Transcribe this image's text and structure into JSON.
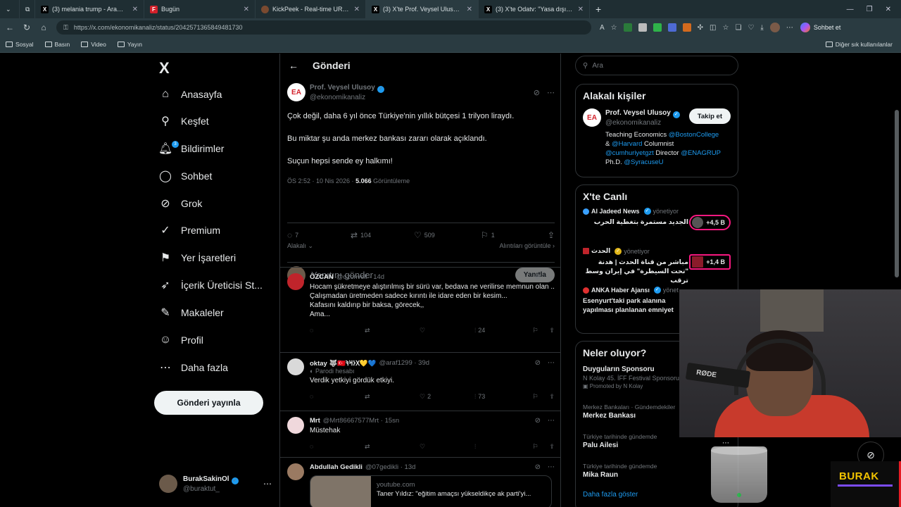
{
  "browser": {
    "tabs": [
      {
        "label": "(3) melania trump - Arama / X",
        "fav": "X",
        "active": false
      },
      {
        "label": "Bugün",
        "fav": "F",
        "active": false
      },
      {
        "label": "KickPeek - Real-time URL Crawler",
        "fav": "",
        "active": false
      },
      {
        "label": "(3) X'te Prof. Veysel Ulusoy: \"Çok d",
        "fav": "X",
        "active": true
      },
      {
        "label": "(3) X'te Odatv: \"Yasa dışı bahis fa...",
        "fav": "X",
        "active": false
      }
    ],
    "url": "https://x.com/ekonomikanaliz/status/2042571365849481730",
    "copilot_label": "Sohbet et",
    "bookmarks": [
      "Sosyal",
      "Basın",
      "Video",
      "Yayın"
    ],
    "bookmarks_right": "Diğer sık kullanılanlar"
  },
  "nav": {
    "logo": "X",
    "items": [
      {
        "label": "Anasayfa",
        "icon": "home-icon",
        "glyph": "⌂"
      },
      {
        "label": "Keşfet",
        "icon": "search-icon",
        "glyph": "⚲"
      },
      {
        "label": "Bildirimler",
        "icon": "bell-icon",
        "glyph": "🔔︎",
        "badge": "3"
      },
      {
        "label": "Sohbet",
        "icon": "chat-icon",
        "glyph": "◯"
      },
      {
        "label": "Grok",
        "icon": "grok-icon",
        "glyph": "⊘"
      },
      {
        "label": "Premium",
        "icon": "premium-icon",
        "glyph": "✓"
      },
      {
        "label": "Yer İşaretleri",
        "icon": "bookmark-icon",
        "glyph": "⚑"
      },
      {
        "label": "İçerik Üreticisi St...",
        "icon": "rocket-icon",
        "glyph": "➶"
      },
      {
        "label": "Makaleler",
        "icon": "article-icon",
        "glyph": "✎"
      },
      {
        "label": "Profil",
        "icon": "profile-icon",
        "glyph": "☺"
      },
      {
        "label": "Daha fazla",
        "icon": "more-icon",
        "glyph": "⋯"
      }
    ],
    "post_button": "Gönderi yayınla",
    "me": {
      "name": "BurakSakinOl",
      "handle": "@buraktut_"
    }
  },
  "main": {
    "header": "Gönderi",
    "post": {
      "author": "Prof. Veysel Ulusoy",
      "handle": "@ekonomikanaliz",
      "avatar_text": "EA",
      "lines": [
        "Çok değil, daha 6 yıl önce Türkiye'nin yıllık bütçesi 1 trilyon liraydı.",
        "Bu miktar şu anda merkez bankası zararı olarak açıklandı.",
        "Suçun hepsi sende ey halkımı!"
      ],
      "meta_time": "ÖS 2:52 · 10 Nis 2026 · ",
      "meta_views": "5.066",
      "meta_views_label": " Görüntüleme",
      "stats": {
        "replies": "7",
        "reposts": "104",
        "likes": "509",
        "bookmarks": "1"
      },
      "related": "Alakalı",
      "quotes": "Alıntıları görüntüle"
    },
    "reply_placeholder": "Yanıtını gönder",
    "reply_button": "Yanıtla",
    "comments": [
      {
        "name": "ÖZCAN",
        "handle": "@ozcnvell · 14d",
        "text": "Hocam şükretmeye alıştırılmış bir sürü var, bedava ne verilirse memnun olan ..\nÇalışmadan üretmeden sadece kırıntı ile idare eden bir kesim...\nKafasını kaldırıp bir baksa, görecek,,\nAma...",
        "replies": "",
        "reposts": "",
        "likes": "",
        "views": "24",
        "color": "#c0242b"
      },
      {
        "name": "oktay 🐺🇹🇷𐰓𐰆𐰺𐰚💛💙",
        "handle": "@araf1299 · 39d",
        "parody": "Parodi hesabı",
        "text": "Verdik yetkiyi gördük etkiyi.",
        "replies": "",
        "reposts": "",
        "likes": "2",
        "views": "73",
        "color": "#d9d9d9"
      },
      {
        "name": "Mrt",
        "handle": "@Mrt86667577Mrt · 15sn",
        "text": "Müstehak",
        "replies": "",
        "reposts": "",
        "likes": "",
        "views": "",
        "color": "#f0d8dc"
      },
      {
        "name": "Abdullah Gedikli",
        "handle": "@07gedikli · 13d",
        "card_site": "youtube.com",
        "card_title": "Taner Yıldız: \"eğitim amaçsı yükseldikçe ak parti'yi...",
        "color": "#9a7a62"
      }
    ]
  },
  "right": {
    "search_placeholder": "Ara",
    "people_title": "Alakalı kişiler",
    "person": {
      "name": "Prof. Veysel Ulusoy",
      "handle": "@ekonomikanaliz",
      "follow": "Takip et",
      "bio_1": "Teaching Economics ",
      "bio_l1": "@BostonCollege",
      "bio_2": "& ",
      "bio_l2": "@Harvard",
      "bio_3": " Columnist",
      "bio_l3": "@cumhuriyetgzt",
      "bio_4": " Director ",
      "bio_l4": "@ENAGRUP",
      "bio_5": "Ph.D. ",
      "bio_l5": "@SyracuseU"
    },
    "live_title": "X'te Canlı",
    "live": [
      {
        "source": "Al Jadeed News",
        "status": "yönetiyor",
        "text": "الجديد مستمرة بتغطية الحرب",
        "count": "+4,5 B",
        "dot": "#3aa0ff"
      },
      {
        "source": "الحدث",
        "status": "yönetiyor",
        "text": "مباشر من قناة الحدث | هدنة \"تحت السيطرة\" في إيران وسط ترقب",
        "count": "+1,4 B",
        "dot": "#c0242b"
      },
      {
        "source": "ANKA Haber Ajansı",
        "status": "yönet",
        "text": "Esenyurt'taki park alanına yapılması planlanan emniyet",
        "count": "",
        "dot": "#e03030"
      }
    ],
    "trends_title": "Neler oluyor?",
    "trends": [
      {
        "top": "",
        "name": "Duyguların Sponsoru",
        "sub": "N Kolay 45. İFF Festival Sponsoru",
        "promo": "Promoted by N Kolay"
      },
      {
        "top": "Merkez Bankaları · Gündemdekiler",
        "name": "Merkez Bankası",
        "sub": ""
      },
      {
        "top": "Türkiye tarihinde gündemde",
        "name": "Palu Ailesi",
        "sub": ""
      },
      {
        "top": "Türkiye tarihinde gündemde",
        "name": "Mika Raun",
        "sub": ""
      }
    ],
    "show_more": "Daha fazla göster"
  },
  "overlay": {
    "brand": "BURAK",
    "mic_label": "RØDE"
  }
}
